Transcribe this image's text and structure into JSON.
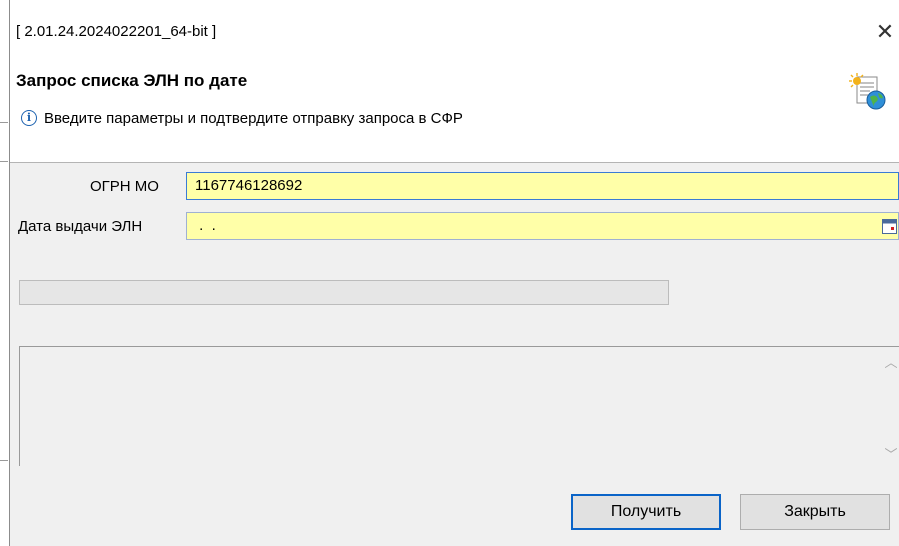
{
  "window": {
    "title": "[ 2.01.24.2024022201_64-bit ]",
    "close_glyph": "✕"
  },
  "header": {
    "heading": "Запрос списка ЭЛН по дате",
    "info_glyph": "i",
    "info_text": "Введите параметры и подтвердите отправку запроса в СФР",
    "icon": "wizard-document-globe-icon"
  },
  "form": {
    "ogrn_label": "ОГРН МО",
    "ogrn_value": "1167746128692",
    "date_label": "Дата выдачи ЭЛН",
    "date_value": " .  ."
  },
  "progress": {
    "value": 0
  },
  "log": {
    "text": ""
  },
  "buttons": {
    "get_label": "Получить",
    "close_label": "Закрыть"
  },
  "colors": {
    "field_bg": "#ffffa8",
    "accent": "#0a64c8"
  }
}
